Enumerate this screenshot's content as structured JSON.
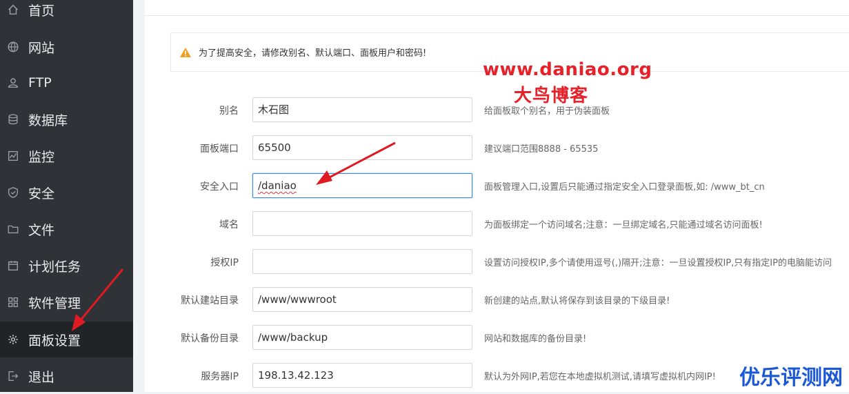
{
  "sidebar": {
    "items": [
      {
        "label": "首页",
        "icon": "home-icon"
      },
      {
        "label": "网站",
        "icon": "globe-icon"
      },
      {
        "label": "FTP",
        "icon": "ftp-user-icon"
      },
      {
        "label": "数据库",
        "icon": "database-icon"
      },
      {
        "label": "监控",
        "icon": "monitor-icon"
      },
      {
        "label": "安全",
        "icon": "shield-icon"
      },
      {
        "label": "文件",
        "icon": "folder-icon"
      },
      {
        "label": "计划任务",
        "icon": "calendar-icon"
      },
      {
        "label": "软件管理",
        "icon": "grid-icon"
      },
      {
        "label": "面板设置",
        "icon": "gear-icon",
        "active": true
      },
      {
        "label": "退出",
        "icon": "logout-icon"
      }
    ]
  },
  "alert": {
    "message": "为了提高安全，请修改别名、默认端口、面板用户和密码!",
    "icon": "warning-icon"
  },
  "watermark": {
    "url": "www.daniao.org",
    "name": "大鸟博客",
    "corner": "优乐评测网"
  },
  "form": {
    "rows": [
      {
        "label": "别名",
        "value": "木石图",
        "hint": "给面板取个别名，用于伪装面板"
      },
      {
        "label": "面板端口",
        "value": "65500",
        "hint": "建议端口范围8888 - 65535"
      },
      {
        "label": "安全入口",
        "value": "/daniao",
        "hint": "面板管理入口,设置后只能通过指定安全入口登录面板,如: /www_bt_cn",
        "focused": true
      },
      {
        "label": "域名",
        "value": "",
        "hint": "为面板绑定一个访问域名;注意：一旦绑定域名,只能通过域名访问面板!"
      },
      {
        "label": "授权IP",
        "value": "",
        "hint": "设置访问授权IP,多个请使用逗号(,)隔开;注意：一旦设置授权IP,只有指定IP的电脑能访问"
      },
      {
        "label": "默认建站目录",
        "value": "/www/wwwroot",
        "hint": "新创建的站点,默认将保存到该目录的下级目录!"
      },
      {
        "label": "默认备份目录",
        "value": "/www/backup",
        "hint": "网站和数据库的备份目录!"
      },
      {
        "label": "服务器IP",
        "value": "198.13.42.123",
        "hint": "默认为外网IP,若您在本地虚拟机测试,请填写虚拟机内网IP!"
      }
    ]
  },
  "colors": {
    "sidebar_bg": "#2f3337",
    "sidebar_active": "#212427",
    "watermark_red": "#e8202a",
    "watermark_blue": "#1b58d8",
    "focus_border": "#3a86d6"
  }
}
